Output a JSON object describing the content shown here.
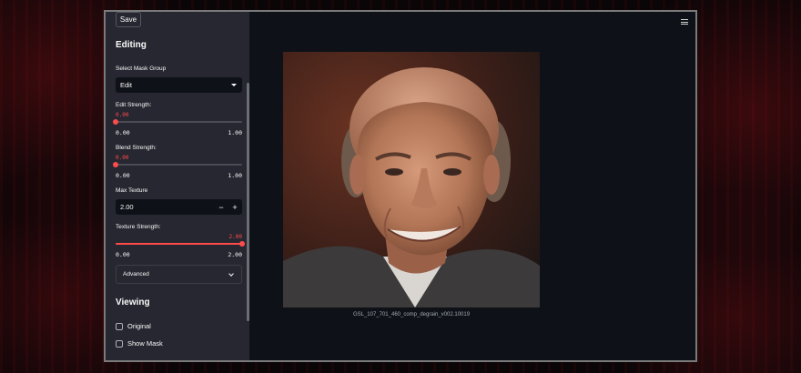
{
  "sidebar": {
    "save_label": "Save",
    "editing_heading": "Editing",
    "mask_group": {
      "label": "Select Mask Group",
      "value": "Edit"
    },
    "edit_strength": {
      "label": "Edit Strength:",
      "value": "0.00",
      "min": "0.00",
      "max": "1.00",
      "fraction": 0.0
    },
    "blend_strength": {
      "label": "Blend Strength:",
      "value": "0.00",
      "min": "0.00",
      "max": "1.00",
      "fraction": 0.0
    },
    "max_texture": {
      "label": "Max Texture",
      "value": "2.00",
      "minus": "−",
      "plus": "+"
    },
    "texture_strength": {
      "label": "Texture Strength:",
      "value": "2.00",
      "min": "0.00",
      "max": "2.00",
      "fraction": 1.0
    },
    "advanced_label": "Advanced",
    "viewing_heading": "Viewing",
    "checkboxes": [
      {
        "label": "Original",
        "checked": false
      },
      {
        "label": "Show Mask",
        "checked": false
      }
    ]
  },
  "main": {
    "image_caption": "GSL_107_701_460_comp_degrain_v002.10019",
    "image_icon": "portrait-photo"
  },
  "colors": {
    "accent": "#ff4b4b",
    "sidebar_bg": "#262730",
    "main_bg": "#0e1117"
  }
}
